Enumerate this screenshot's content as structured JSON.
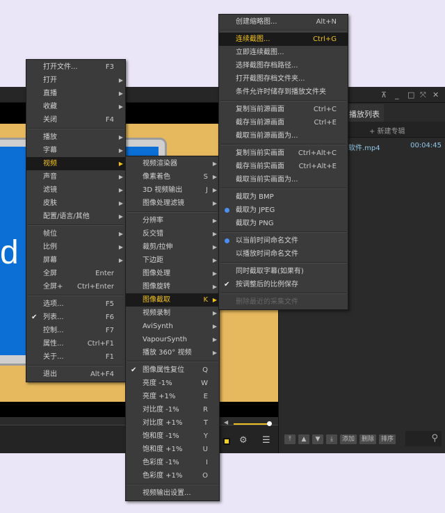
{
  "colors": {
    "background": "#ebe6f7",
    "menu_bg": "#3b3b3b",
    "highlight_text": "#f2c21c",
    "video_bg": "#e7b95e",
    "screen_blue": "#0b6fd6"
  },
  "window": {
    "controls": [
      "pin-icon",
      "minimize-icon",
      "maximize-icon",
      "fullscreen-icon",
      "close-icon"
    ],
    "video_text": "d"
  },
  "playlist": {
    "tab": "播放列表",
    "new_album": "+ 新建专辑",
    "items": [
      {
        "name": "软件.mp4",
        "duration": "00:04:45"
      }
    ],
    "buttons": {
      "top": "⤒",
      "up": "▲",
      "down": "▼",
      "bottom": "⤓",
      "add": "添加",
      "delete": "删除",
      "sort": "排序"
    }
  },
  "controls": {
    "volume": 1.0
  },
  "menus": [
    {
      "id": "main",
      "items": [
        {
          "label": "打开文件...",
          "shortcut": "F3"
        },
        {
          "label": "打开",
          "arrow": true
        },
        {
          "label": "直播",
          "arrow": true
        },
        {
          "label": "收藏",
          "arrow": true
        },
        {
          "label": "关闭",
          "shortcut": "F4"
        },
        {
          "sep": true
        },
        {
          "label": "播放",
          "arrow": true
        },
        {
          "label": "字幕",
          "arrow": true
        },
        {
          "label": "视频",
          "arrow": true,
          "highlighted": true
        },
        {
          "label": "声音",
          "arrow": true
        },
        {
          "label": "滤镜",
          "arrow": true
        },
        {
          "label": "皮肤",
          "arrow": true
        },
        {
          "label": "配置/语言/其他",
          "arrow": true
        },
        {
          "sep": true
        },
        {
          "label": "帧位",
          "arrow": true
        },
        {
          "label": "比例",
          "arrow": true
        },
        {
          "label": "屏幕",
          "arrow": true
        },
        {
          "label": "全屏",
          "shortcut": "Enter"
        },
        {
          "label": "全屏+",
          "shortcut": "Ctrl+Enter"
        },
        {
          "sep": true
        },
        {
          "label": "选项...",
          "shortcut": "F5"
        },
        {
          "label": "列表...",
          "shortcut": "F6",
          "check": true
        },
        {
          "label": "控制...",
          "shortcut": "F7"
        },
        {
          "label": "属性...",
          "shortcut": "Ctrl+F1"
        },
        {
          "label": "关于...",
          "shortcut": "F1"
        },
        {
          "sep": true
        },
        {
          "label": "退出",
          "shortcut": "Alt+F4"
        }
      ]
    },
    {
      "id": "video",
      "items": [
        {
          "label": "视频渲染器",
          "arrow": true
        },
        {
          "label": "像素着色",
          "shortcut": "S",
          "arrow": true
        },
        {
          "label": "3D 视频输出",
          "shortcut": "J",
          "arrow": true
        },
        {
          "label": "图像处理滤镜",
          "arrow": true
        },
        {
          "sep": true
        },
        {
          "label": "分辨率",
          "arrow": true
        },
        {
          "label": "反交错",
          "arrow": true
        },
        {
          "label": "裁剪/拉伸",
          "arrow": true
        },
        {
          "label": "下边距",
          "arrow": true
        },
        {
          "label": "图像处理",
          "arrow": true
        },
        {
          "label": "图像旋转",
          "arrow": true
        },
        {
          "label": "图像截取",
          "shortcut": "K",
          "arrow": true,
          "highlighted": true
        },
        {
          "label": "视频录制",
          "arrow": true
        },
        {
          "label": "AviSynth",
          "arrow": true
        },
        {
          "label": "VapourSynth",
          "arrow": true
        },
        {
          "label": "播放 360° 视频",
          "arrow": true
        },
        {
          "sep": true
        },
        {
          "label": "图像属性复位",
          "shortcut": "Q",
          "check": true
        },
        {
          "label": "亮度 -1%",
          "shortcut": "W"
        },
        {
          "label": "亮度 +1%",
          "shortcut": "E"
        },
        {
          "label": "对比度 -1%",
          "shortcut": "R"
        },
        {
          "label": "对比度 +1%",
          "shortcut": "T"
        },
        {
          "label": "饱和度 -1%",
          "shortcut": "Y"
        },
        {
          "label": "饱和度 +1%",
          "shortcut": "U"
        },
        {
          "label": "色彩度 -1%",
          "shortcut": "I"
        },
        {
          "label": "色彩度 +1%",
          "shortcut": "O"
        },
        {
          "sep": true
        },
        {
          "label": "视频输出设置..."
        }
      ]
    },
    {
      "id": "capture",
      "items": [
        {
          "label": "创建缩略图...",
          "shortcut": "Alt+N"
        },
        {
          "sep": true
        },
        {
          "label": "连续截图...",
          "shortcut": "Ctrl+G",
          "highlighted": true
        },
        {
          "label": "立即连续截图..."
        },
        {
          "label": "选择截图存档路径..."
        },
        {
          "label": "打开截图存档文件夹..."
        },
        {
          "label": "条件允许时储存到播放文件夹"
        },
        {
          "sep": true
        },
        {
          "label": "复制当前源画面",
          "shortcut": "Ctrl+C"
        },
        {
          "label": "截存当前源画面",
          "shortcut": "Ctrl+E"
        },
        {
          "label": "截取当前源画面为..."
        },
        {
          "sep": true
        },
        {
          "label": "复制当前实画面",
          "shortcut": "Ctrl+Alt+C"
        },
        {
          "label": "截存当前实画面",
          "shortcut": "Ctrl+Alt+E"
        },
        {
          "label": "截取当前实画面为..."
        },
        {
          "sep": true
        },
        {
          "label": "截取为 BMP"
        },
        {
          "label": "截取为 JPEG",
          "radio": true
        },
        {
          "label": "截取为 PNG"
        },
        {
          "sep": true
        },
        {
          "label": "以当前时间命名文件",
          "radio": true
        },
        {
          "label": "以播放时间命名文件"
        },
        {
          "sep": true
        },
        {
          "label": "同时截取字幕(如果有)"
        },
        {
          "label": "按调整后的比例保存",
          "check": true
        },
        {
          "sep": true
        },
        {
          "label": "删除最近的采集文件",
          "disabled": true
        }
      ]
    }
  ]
}
